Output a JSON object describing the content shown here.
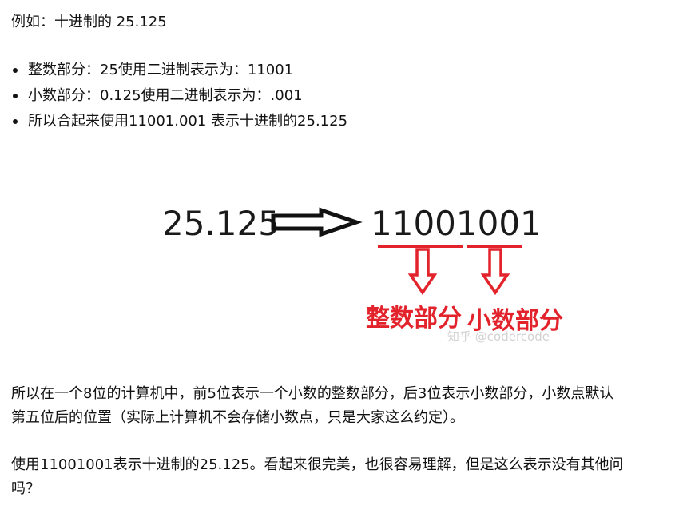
{
  "intro": "例如：十进制的 25.125",
  "bullets": [
    "整数部分：25使用二进制表示为：11001",
    "小数部分：0.125使用二进制表示为：.001",
    "所以合起来使用11001.001 表示十进制的25.125"
  ],
  "figure": {
    "decimal": "25.125",
    "binary": "11001001",
    "int_label": "整数部分",
    "frac_label": "小数部分",
    "watermark": "知乎 @codercode",
    "colors": {
      "accent": "#e3232c",
      "text": "#1a1a1a",
      "watermark": "#d2d2d2"
    }
  },
  "para1": {
    "line1": "所以在一个8位的计算机中，前5位表示一个小数的整数部分，后3位表示小数部分，小数点默认",
    "line2": "第五位后的位置（实际上计算机不会存储小数点，只是大家这么约定）。"
  },
  "para2": {
    "line1": "使用11001001表示十进制的25.125。看起来很完美，也很容易理解，但是这么表示没有其他问",
    "line2": "吗？"
  }
}
